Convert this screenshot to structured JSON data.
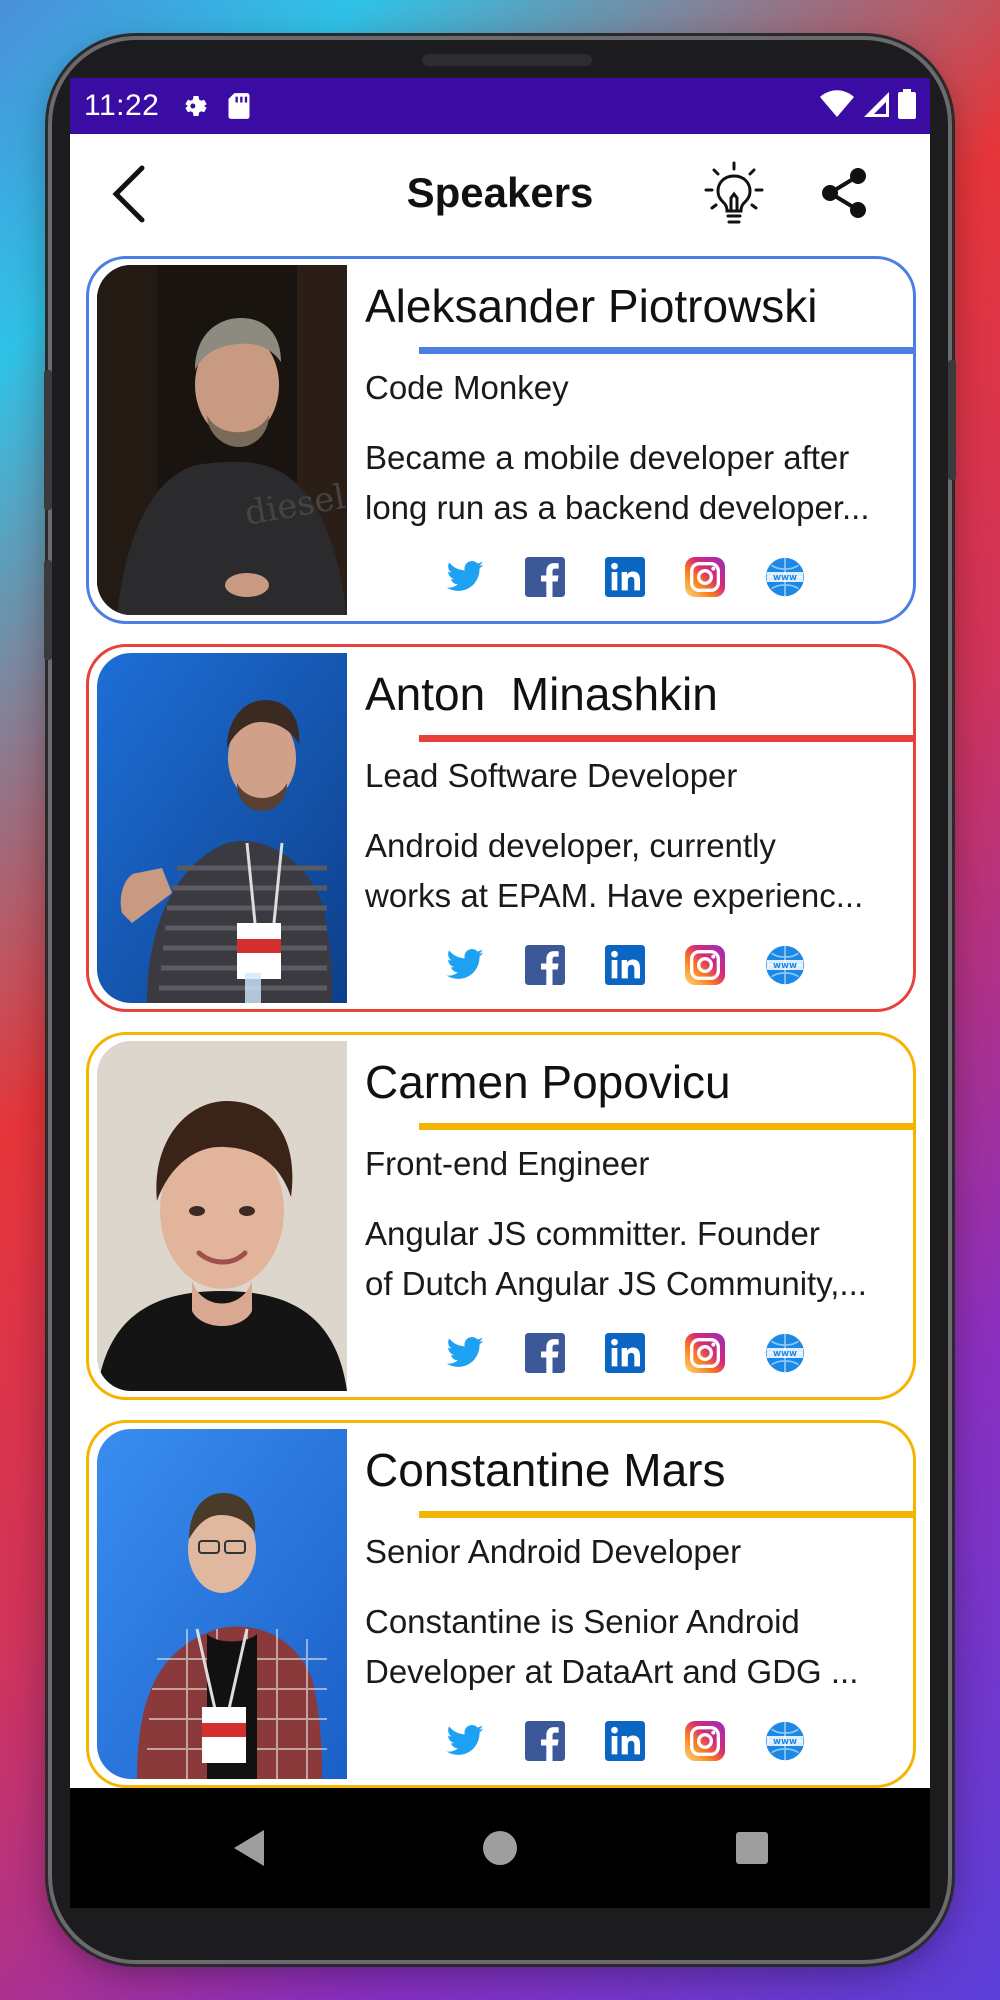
{
  "status_bar": {
    "time": "11:22",
    "color": "#3a0ca3"
  },
  "app_bar": {
    "title": "Speakers",
    "back_icon": "chevron-left-icon",
    "theme_icon": "lightbulb-icon",
    "share_icon": "share-icon"
  },
  "speakers": [
    {
      "name": "Aleksander Piotrowski",
      "role": "Code Monkey",
      "bio_line1": "Became a mobile developer after",
      "bio_line2": "long run as a backend developer...",
      "accent": "#4a7fe6"
    },
    {
      "name": "Anton  Minashkin",
      "role": "Lead Software Developer",
      "bio_line1": "Android developer, currently",
      "bio_line2": "works at EPAM. Have experienc...",
      "accent": "#e8413a"
    },
    {
      "name": "Carmen Popovicu",
      "role": "Front-end Engineer",
      "bio_line1": "Angular JS committer. Founder",
      "bio_line2": "of Dutch Angular JS Community,...",
      "accent": "#f4b400"
    },
    {
      "name": "Constantine Mars",
      "role": "Senior Android Developer",
      "bio_line1": "Constantine is Senior Android",
      "bio_line2": "Developer at DataArt and GDG ...",
      "accent": "#f4b400"
    }
  ],
  "social_icons": [
    "twitter-icon",
    "facebook-icon",
    "linkedin-icon",
    "instagram-icon",
    "website-icon"
  ],
  "nav_bar": {
    "back": "nav-back-icon",
    "home": "nav-home-icon",
    "recents": "nav-recents-icon"
  }
}
